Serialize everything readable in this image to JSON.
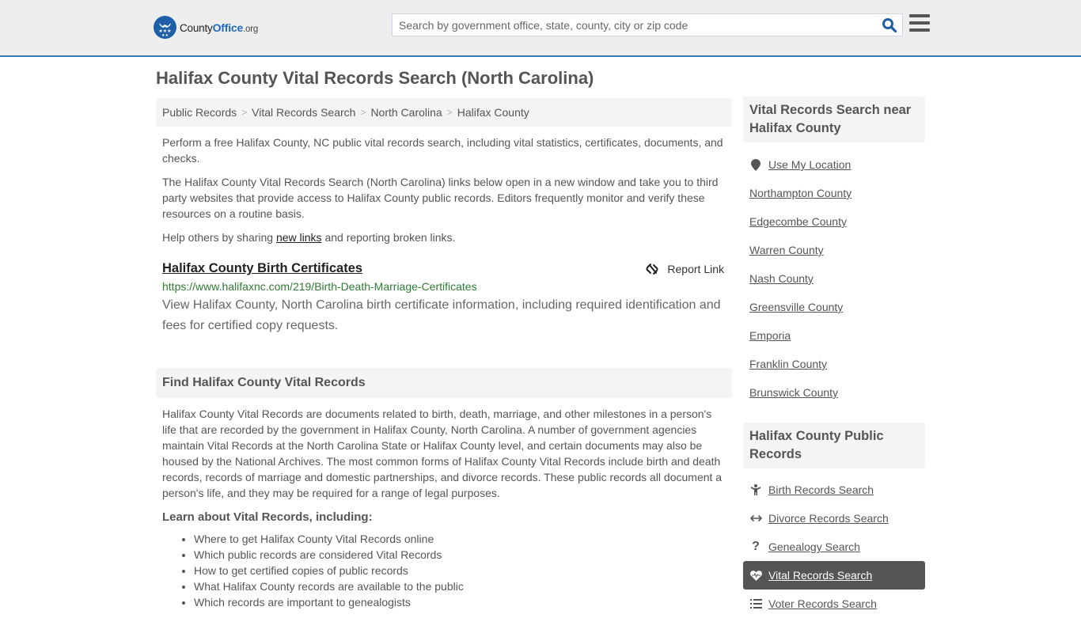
{
  "header": {
    "logo": {
      "brand_a": "County",
      "brand_b": "Office",
      "brand_c": ".org"
    },
    "search": {
      "placeholder": "Search by government office, state, county, city or zip code",
      "value": ""
    },
    "search_icon": "search-icon",
    "menu_icon": "hamburger-menu-icon",
    "accent_color": "#3a7bb0"
  },
  "page": {
    "title": "Halifax County Vital Records Search (North Carolina)"
  },
  "breadcrumb": [
    {
      "label": "Public Records"
    },
    {
      "label": "Vital Records Search"
    },
    {
      "label": "North Carolina"
    },
    {
      "label": "Halifax County"
    }
  ],
  "breadcrumb_separator": ">",
  "intro": {
    "p1": "Perform a free Halifax County, NC public vital records search, including vital statistics, certificates, documents, and checks.",
    "p2": "The Halifax County Vital Records Search (North Carolina) links below open in a new window and take you to third party websites that provide access to Halifax County public records. Editors frequently monitor and verify these resources on a routine basis.",
    "p3_before": "Help others by sharing ",
    "p3_link": "new links",
    "p3_after": " and reporting broken links."
  },
  "links": [
    {
      "title": "Halifax County Birth Certificates",
      "url": "https://www.halifaxnc.com/219/Birth-Death-Marriage-Certificates",
      "description": "View Halifax County, North Carolina birth certificate information, including required identification and fees for certified copy requests.",
      "report_label": "Report Link",
      "report_icon": "broken-link-icon"
    }
  ],
  "find_section": {
    "heading": "Find Halifax County Vital Records",
    "body": "Halifax County Vital Records are documents related to birth, death, marriage, and other milestones in a person's life that are recorded by the government in Halifax County, North Carolina. A number of government agencies maintain Vital Records at the North Carolina State or Halifax County level, and certain documents may also be housed by the National Archives. The most common forms of Halifax County Vital Records include birth and death records, records of marriage and domestic partnerships, and divorce records. These public records all document a person's life, and they may be required for a range of legal purposes.",
    "learn_heading": "Learn about Vital Records, including:",
    "learn_items": [
      "Where to get Halifax County Vital Records online",
      "Which public records are considered Vital Records",
      "How to get certified copies of public records",
      "What Halifax County records are available to the public",
      "Which records are important to genealogists"
    ]
  },
  "sidebar": {
    "near_heading": "Vital Records Search near Halifax County",
    "use_location": "Use My Location",
    "near_items": [
      "Northampton County",
      "Edgecombe County",
      "Warren County",
      "Nash County",
      "Greensville County",
      "Emporia",
      "Franklin County",
      "Brunswick County"
    ],
    "public_records_heading": "Halifax County Public Records",
    "public_records_items": [
      {
        "label": "Birth Records Search",
        "icon": "child-icon",
        "active": false
      },
      {
        "label": "Divorce Records Search",
        "icon": "arrows-horizontal-icon",
        "active": false
      },
      {
        "label": "Genealogy Search",
        "icon": "question-icon",
        "active": false
      },
      {
        "label": "Vital Records Search",
        "icon": "heartbeat-icon",
        "active": true
      },
      {
        "label": "Voter Records Search",
        "icon": "list-icon",
        "active": false
      }
    ]
  }
}
